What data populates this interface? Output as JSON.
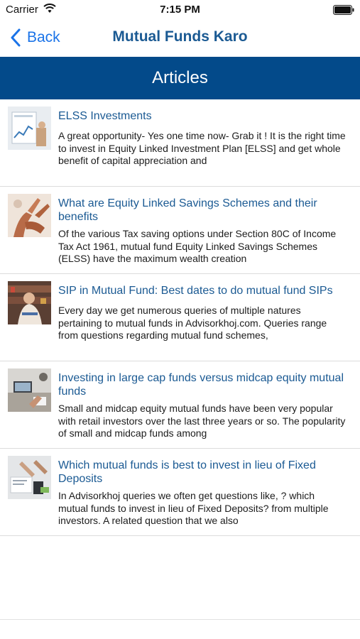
{
  "status_bar": {
    "carrier": "Carrier",
    "time": "7:15 PM"
  },
  "nav": {
    "back_label": "Back",
    "title": "Mutual Funds Karo",
    "back_icon": "chevron-left-icon"
  },
  "section": {
    "title": "Articles"
  },
  "articles": [
    {
      "title": "ELSS Investments",
      "excerpt": "A great opportunity- Yes one time now- Grab it ! It is the right time to invest in Equity Linked Investment Plan [ELSS] and get whole benefit of capital appreciation and"
    },
    {
      "title": "What are Equity Linked Savings Schemes and their benefits",
      "excerpt": "Of the various Tax saving options under Section 80C of Income Tax Act 1961, mutual fund Equity Linked Savings Schemes (ELSS) have the maximum wealth creation"
    },
    {
      "title": "SIP in Mutual Fund: Best dates to do mutual fund SIPs",
      "excerpt": "Every day we get numerous queries of multiple natures pertaining to mutual funds in Advisorkhoj.com. Queries range from questions regarding mutual fund schemes,"
    },
    {
      "title": "Investing in large cap funds versus midcap equity mutual funds",
      "excerpt": "Small and midcap equity mutual funds have been very popular with retail investors over the last three years or so. The popularity of small and midcap funds among"
    },
    {
      "title": "Which mutual funds is best to invest in lieu of Fixed Deposits",
      "excerpt": "In Advisorkhoj queries we often get questions like, ? which mutual funds to invest in lieu of Fixed Deposits? from multiple investors. A related question that we also"
    }
  ],
  "colors": {
    "accent_blue": "#1a73e8",
    "title_blue": "#1b5a93",
    "header_bg": "#034a8a"
  }
}
